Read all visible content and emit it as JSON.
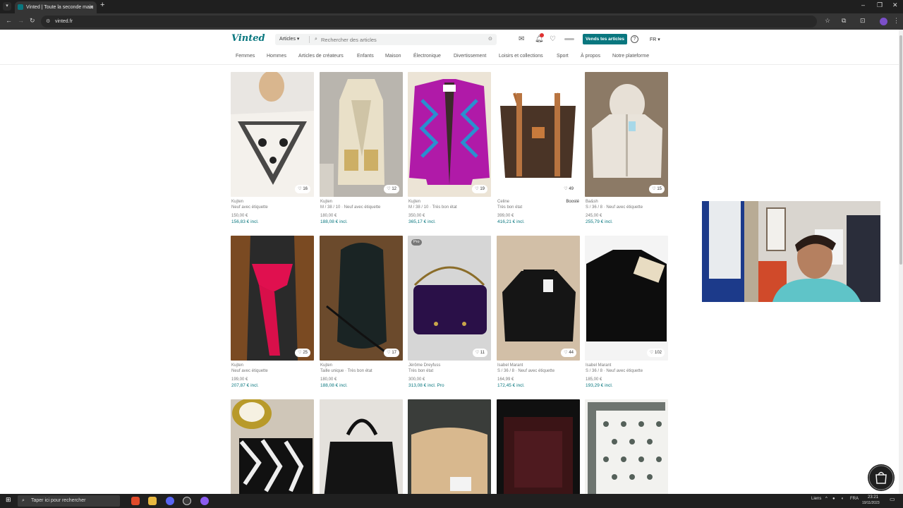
{
  "browser": {
    "tab_title": "Vinted | Toute la seconde main",
    "tab_close": "✕",
    "new_tab": "+",
    "url": "vinted.fr",
    "window_controls": [
      "–",
      "❐",
      "✕"
    ]
  },
  "header": {
    "logo": "Vinted",
    "search_category": "Articles ▾",
    "search_placeholder": "Rechercher des articles",
    "sell_button": "Vends tes articles",
    "language": "FR ▾",
    "help": "?"
  },
  "nav": [
    "Femmes",
    "Hommes",
    "Articles de créateurs",
    "Enfants",
    "Maison",
    "Électronique",
    "Divertissement",
    "Loisirs et collections",
    "Sport",
    "À propos",
    "Notre plateforme"
  ],
  "items": [
    {
      "brand": "Kujten",
      "details": "Neuf avec étiquette",
      "bumped": "",
      "price": "150,00 €",
      "incl": "156,83 € incl.",
      "likes": "16",
      "pro": ""
    },
    {
      "brand": "Kujten",
      "details": "M / 38 / 10 · Neuf avec étiquette",
      "bumped": "",
      "price": "180,00 €",
      "incl": "188,08 € incl.",
      "likes": "12",
      "pro": ""
    },
    {
      "brand": "Kujten",
      "details": "M / 38 / 10 · Très bon état",
      "bumped": "",
      "price": "350,00 €",
      "incl": "365,17 € incl.",
      "likes": "19",
      "pro": ""
    },
    {
      "brand": "Celine",
      "details": "Très bon état",
      "bumped": "Boosté",
      "price": "399,00 €",
      "incl": "416,21 € incl.",
      "likes": "49",
      "pro": ""
    },
    {
      "brand": "Ba&sh",
      "details": "S / 36 / 8 · Neuf avec étiquette",
      "bumped": "",
      "price": "245,00 €",
      "incl": "255,79 € incl.",
      "likes": "15",
      "pro": ""
    },
    {
      "brand": "Kujten",
      "details": "Neuf avec étiquette",
      "bumped": "",
      "price": "199,00 €",
      "incl": "207,87 € incl.",
      "likes": "25",
      "pro": ""
    },
    {
      "brand": "Kujten",
      "details": "Taille unique · Très bon état",
      "bumped": "",
      "price": "180,00 €",
      "incl": "188,08 € incl.",
      "likes": "17",
      "pro": ""
    },
    {
      "brand": "Jérôme Dreyfuss",
      "details": "Très bon état",
      "bumped": "",
      "price": "300,00 €",
      "incl": "313,08 € incl. Pro",
      "likes": "11",
      "pro": "Pro"
    },
    {
      "brand": "Isabel Marant",
      "details": "S / 36 / 8 · Neuf avec étiquette",
      "bumped": "",
      "price": "164,99 €",
      "incl": "172,45 € incl.",
      "likes": "44",
      "pro": ""
    },
    {
      "brand": "Isabel Marant",
      "details": "S / 36 / 8 · Neuf avec étiquette",
      "bumped": "",
      "price": "185,00 €",
      "incl": "193,29 € incl.",
      "likes": "102",
      "pro": ""
    }
  ],
  "taskbar": {
    "search_placeholder": "Taper ici pour rechercher",
    "links": "Liens",
    "lang": "FRA",
    "time": "23:21",
    "date": "19/11/2023"
  }
}
